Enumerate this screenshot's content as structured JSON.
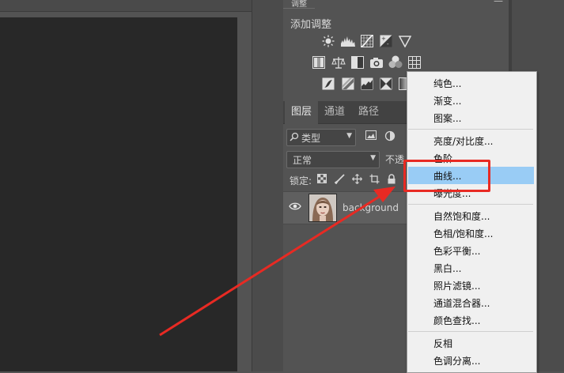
{
  "adjustments_panel": {
    "tab_label": "调整",
    "title": "添加调整",
    "menu_glyph": "—"
  },
  "layers_panel": {
    "tabs": [
      "图层",
      "通道",
      "路径"
    ],
    "filter_label": "类型",
    "blend_mode": "正常",
    "opacity_label": "不透",
    "lock_label": "锁定:",
    "layer": {
      "name": "background"
    }
  },
  "context_menu": {
    "items": [
      "纯色...",
      "渐变...",
      "图案...",
      "亮度/对比度...",
      "色阶...",
      "曲线...",
      "曝光度...",
      "自然饱和度...",
      "色相/饱和度...",
      "色彩平衡...",
      "黑白...",
      "照片滤镜...",
      "通道混合器...",
      "颜色查找...",
      "反相",
      "色调分离..."
    ],
    "highlighted": "曲线..."
  },
  "colors": {
    "highlight": "#99ccf5",
    "annotation_red": "#e82a23",
    "panel_bg": "#535353",
    "canvas_bg": "#282828"
  },
  "icons": {
    "adjustment_row1": [
      "brightness-icon",
      "levels-icon",
      "curves-icon",
      "exposure-icon",
      "vibrance-icon"
    ],
    "adjustment_row2": [
      "hue-saturation-icon",
      "color-balance-icon",
      "black-white-icon",
      "photo-filter-icon",
      "channel-mixer-icon",
      "color-lookup-icon"
    ],
    "adjustment_row3": [
      "invert-icon",
      "posterize-icon",
      "threshold-icon",
      "selective-color-icon",
      "gradient-map-icon"
    ]
  }
}
